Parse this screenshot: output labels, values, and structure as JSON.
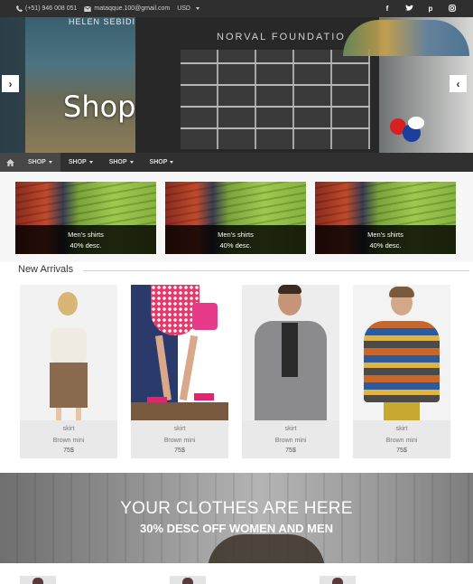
{
  "topbar": {
    "phone": "(+51) 946 008 051",
    "email": "mataqque.100@gmail.com",
    "currency": "USD",
    "social": [
      "facebook-icon",
      "twitter-icon",
      "pinterest-icon",
      "instagram-icon"
    ]
  },
  "hero": {
    "title": "Shop",
    "background_text": "NORVAL FOUNDATIO",
    "banner_text": "HELEN SEBIDI"
  },
  "nav": {
    "items": [
      {
        "label": "SHOP"
      },
      {
        "label": "SHOP"
      },
      {
        "label": "SHOP"
      },
      {
        "label": "SHOP"
      }
    ]
  },
  "promos": [
    {
      "title": "Men's shirts",
      "discount": "40% desc."
    },
    {
      "title": "Men's shirts",
      "discount": "40% desc."
    },
    {
      "title": "Men's shirts",
      "discount": "40% desc."
    }
  ],
  "new_arrivals": {
    "title": "New Arrivals",
    "products": [
      {
        "category": "skirt",
        "name": "Brown mini",
        "price": "75$"
      },
      {
        "category": "skirt",
        "name": "Brown mini",
        "price": "75$"
      },
      {
        "category": "skirt",
        "name": "Brown mini",
        "price": "75$"
      },
      {
        "category": "skirt",
        "name": "Brown mini",
        "price": "75$"
      }
    ]
  },
  "promo_banner": {
    "headline": "YOUR CLOTHES ARE HERE",
    "subline": "30% DESC OFF WOMEN AND MEN"
  },
  "colors": {
    "topbar_bg": "#2f2f2f",
    "nav_bg": "#303030",
    "card_overlay": "#000000",
    "product_bg": "#e9e9e9"
  }
}
